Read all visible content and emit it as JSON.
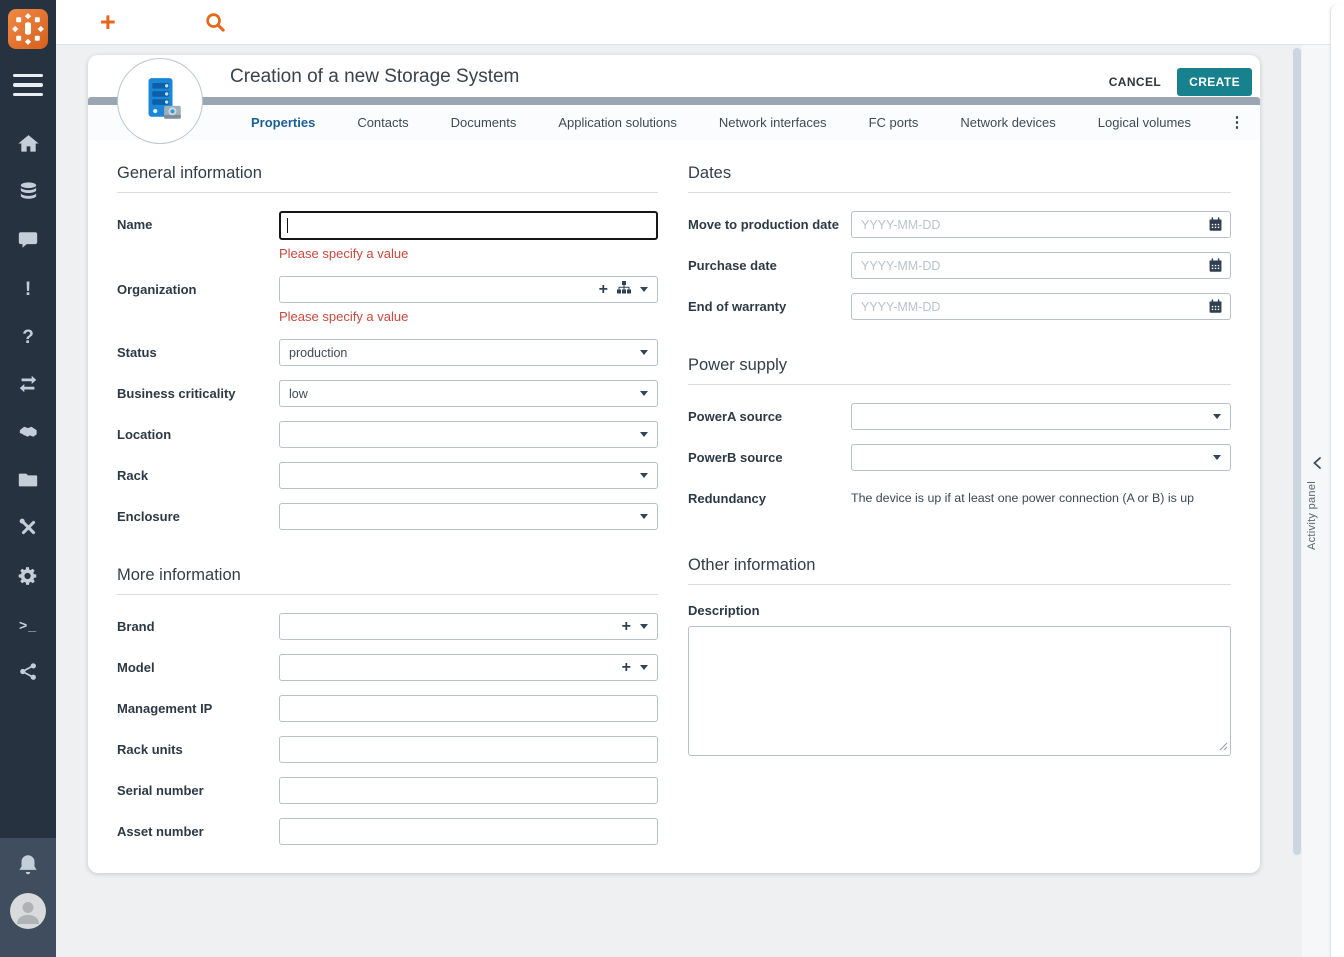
{
  "colors": {
    "accent_orange": "#e8671f",
    "primary_teal": "#17828e",
    "error_red": "#c9493b",
    "sidebar_bg": "#26323f",
    "band_gray": "#9aa6b2"
  },
  "sidebar": {
    "items": [
      "home",
      "database",
      "chat",
      "alert",
      "help",
      "transfers",
      "handshake",
      "documents",
      "tools",
      "settings",
      "terminal",
      "share"
    ],
    "help_glyph": "?",
    "alert_glyph": "!",
    "terminal_glyph": ">_"
  },
  "header": {
    "title": "Creation of a new Storage System",
    "cancel_label": "CANCEL",
    "create_label": "CREATE",
    "overflow_glyph": "⋮"
  },
  "tabs": [
    {
      "label": "Properties",
      "active": true
    },
    {
      "label": "Contacts",
      "active": false
    },
    {
      "label": "Documents",
      "active": false
    },
    {
      "label": "Application solutions",
      "active": false
    },
    {
      "label": "Network interfaces",
      "active": false
    },
    {
      "label": "FC ports",
      "active": false
    },
    {
      "label": "Network devices",
      "active": false
    },
    {
      "label": "Logical volumes",
      "active": false
    }
  ],
  "form": {
    "general": {
      "title": "General information",
      "name": {
        "label": "Name",
        "value": "",
        "error": "Please specify a value"
      },
      "organization": {
        "label": "Organization",
        "value": "",
        "error": "Please specify a value"
      },
      "status": {
        "label": "Status",
        "value": "production"
      },
      "criticality": {
        "label": "Business criticality",
        "value": "low"
      },
      "location": {
        "label": "Location",
        "value": ""
      },
      "rack": {
        "label": "Rack",
        "value": ""
      },
      "enclosure": {
        "label": "Enclosure",
        "value": ""
      }
    },
    "more": {
      "title": "More information",
      "brand": {
        "label": "Brand",
        "value": ""
      },
      "model": {
        "label": "Model",
        "value": ""
      },
      "management_ip": {
        "label": "Management IP",
        "value": ""
      },
      "rack_units": {
        "label": "Rack units",
        "value": ""
      },
      "serial": {
        "label": "Serial number",
        "value": ""
      },
      "asset": {
        "label": "Asset number",
        "value": ""
      }
    },
    "dates": {
      "title": "Dates",
      "move_to_production": {
        "label": "Move to production date",
        "value": "",
        "placeholder": "YYYY-MM-DD"
      },
      "purchase": {
        "label": "Purchase date",
        "value": "",
        "placeholder": "YYYY-MM-DD"
      },
      "end_of_warranty": {
        "label": "End of warranty",
        "value": "",
        "placeholder": "YYYY-MM-DD"
      }
    },
    "power": {
      "title": "Power supply",
      "power_a": {
        "label": "PowerA source",
        "value": ""
      },
      "power_b": {
        "label": "PowerB source",
        "value": ""
      },
      "redundancy": {
        "label": "Redundancy",
        "text": "The device is up if at least one power connection (A or B) is up"
      }
    },
    "other": {
      "title": "Other information",
      "description": {
        "label": "Description",
        "value": ""
      }
    }
  },
  "activity_panel": {
    "label": "Activity panel"
  }
}
